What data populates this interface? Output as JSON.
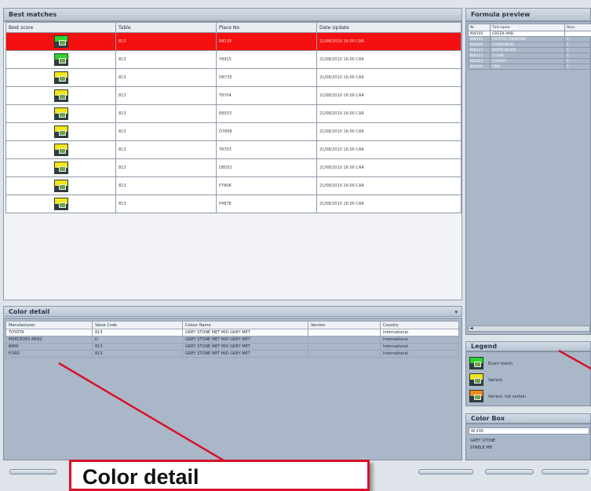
{
  "best_matches": {
    "title": "Best matches",
    "columns": [
      "Best score",
      "Table",
      "Place No",
      "Date Update"
    ],
    "rows": [
      {
        "swatch": "green",
        "table": "813",
        "place": "R8135",
        "date": "21/08/2010 16:00 CAR",
        "selected": true
      },
      {
        "swatch": "green",
        "table": "813",
        "place": "Y8915",
        "date": "21/08/2010 16:00 CAR",
        "selected": false
      },
      {
        "swatch": "yellow",
        "table": "813",
        "place": "D8735",
        "date": "21/08/2010 16:00 CAR",
        "selected": false
      },
      {
        "swatch": "yellow",
        "table": "813",
        "place": "T8704",
        "date": "21/08/2010 16:00 CAR",
        "selected": false
      },
      {
        "swatch": "yellow",
        "table": "813",
        "place": "E8533",
        "date": "21/08/2010 16:00 CAR",
        "selected": false
      },
      {
        "swatch": "yellow",
        "table": "813",
        "place": "D7808",
        "date": "21/08/2010 16:00 CAR",
        "selected": false
      },
      {
        "swatch": "yellow",
        "table": "813",
        "place": "T8703",
        "date": "21/08/2010 16:00 CAR",
        "selected": false
      },
      {
        "swatch": "yellow",
        "table": "813",
        "place": "D8552",
        "date": "21/08/2010 16:00 CAR",
        "selected": false
      },
      {
        "swatch": "yellow",
        "table": "813",
        "place": "P7808",
        "date": "21/08/2010 16:00 CAR",
        "selected": false
      },
      {
        "swatch": "yellow",
        "table": "813",
        "place": "P4878",
        "date": "21/08/2010 16:00 CAR",
        "selected": false
      }
    ]
  },
  "color_detail": {
    "title": "Color detail",
    "collapse_glyph": "▾",
    "columns": [
      "Manufacturer",
      "Value Code",
      "Colour Name",
      "Version",
      "Country"
    ],
    "rows": [
      {
        "c1": "TOYOTA",
        "c2": "813",
        "c3": "GREY STONE MET MID GREY MET",
        "c4": "",
        "c5": "International"
      },
      {
        "c1": "MERCEDES BENZ",
        "c2": "D",
        "c3": "GREY STONE MET MID GREY MET",
        "c4": "",
        "c5": "International"
      },
      {
        "c1": "BMW",
        "c2": "813",
        "c3": "GREY STONE MET MID GREY MET",
        "c4": "",
        "c5": "International"
      },
      {
        "c1": "FORD",
        "c2": "813",
        "c3": "GREY STONE MET MID GREY MET",
        "c4": "",
        "c5": "International"
      }
    ]
  },
  "formula_preview": {
    "title": "Formula preview",
    "columns": [
      "Nr",
      "Tint name",
      "Recs"
    ],
    "rows": [
      {
        "nr": "NW100",
        "name": "GREEN AMB",
        "recs": ""
      },
      {
        "nr": "NW103",
        "name": "CRYSTAL DIAMOND",
        "recs": "1"
      },
      {
        "nr": "NW106",
        "name": "CRIMSON BL",
        "recs": "1"
      },
      {
        "nr": "NW115",
        "name": "WHITE BLUER",
        "recs": "1"
      },
      {
        "nr": "NW122",
        "name": "CLEAR",
        "recs": "1"
      },
      {
        "nr": "NW125",
        "name": "CHERRY",
        "recs": "1"
      },
      {
        "nr": "NW130",
        "name": "FINE",
        "recs": "1"
      }
    ],
    "scroll_left_glyph": "◄"
  },
  "legend": {
    "title": "Legend",
    "items": [
      {
        "swatch": "green",
        "label": "Exact match"
      },
      {
        "swatch": "yellow",
        "label": "Variant"
      },
      {
        "swatch": "orange",
        "label": "Variant, not certain"
      }
    ]
  },
  "color_box": {
    "title": "Color Box",
    "input_value": "W 200",
    "lines": [
      "GREY STONE",
      "STABLE MB"
    ]
  },
  "callout": {
    "text": "Color detail"
  },
  "colors": {
    "selected_row": "#f41010",
    "green_swatch": "#2bd42b",
    "yellow_swatch": "#f1e51c",
    "orange_swatch": "#f28a1b",
    "annotation": "#d6112a",
    "panel": "#a9b7c8"
  }
}
